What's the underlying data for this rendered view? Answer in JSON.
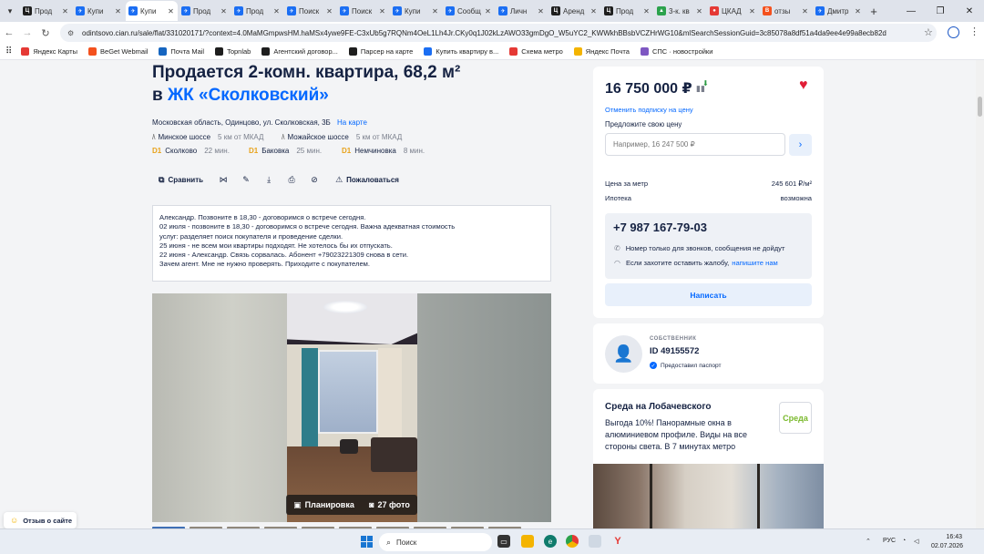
{
  "browser": {
    "tabs": [
      {
        "title": "Прод",
        "color": "#1e1e1e",
        "letter": "Ц"
      },
      {
        "title": "Купи",
        "color": "#1b6ef3",
        "letter": "✈"
      },
      {
        "title": "Купи",
        "color": "#1b6ef3",
        "letter": "✈",
        "active": true
      },
      {
        "title": "Прод",
        "color": "#1b6ef3",
        "letter": "✈"
      },
      {
        "title": "Прод",
        "color": "#1b6ef3",
        "letter": "✈"
      },
      {
        "title": "Поиск",
        "color": "#1b6ef3",
        "letter": "✈"
      },
      {
        "title": "Поиск",
        "color": "#1b6ef3",
        "letter": "✈"
      },
      {
        "title": "Купи",
        "color": "#1b6ef3",
        "letter": "✈"
      },
      {
        "title": "Сообщ",
        "color": "#1b6ef3",
        "letter": "✈"
      },
      {
        "title": "Личн",
        "color": "#1b6ef3",
        "letter": "✈"
      },
      {
        "title": "Аренд",
        "color": "#1e1e1e",
        "letter": "Ц"
      },
      {
        "title": "Прод",
        "color": "#1e1e1e",
        "letter": "Ц"
      },
      {
        "title": "3-к. кв",
        "color": "#2ba24c",
        "letter": "▲"
      },
      {
        "title": "ЦКАД",
        "color": "#e53935",
        "letter": "●"
      },
      {
        "title": "отзы",
        "color": "#f4511e",
        "letter": "B"
      },
      {
        "title": "Дмитр",
        "color": "#1b6ef3",
        "letter": "✈"
      }
    ],
    "url": "odintsovo.cian.ru/sale/flat/331020171/?context=4.0MaMGmpwsHM.haMSx4ywe9FE-C3xUb5g7RQNm4OeL1Lh4Jr.CKy0q1J02kLzAWO33gmDgO_W5uYC2_KWWkhBBsbVCZHrWG10&mlSearchSessionGuid=3c85078a8df51a4da9ee4e99a8ecb82d",
    "bookmarks": [
      {
        "label": "Яндекс Карты",
        "color": "#e53935"
      },
      {
        "label": "BeGet Webmail",
        "color": "#f4511e"
      },
      {
        "label": "Почта Mail",
        "color": "#1565c0"
      },
      {
        "label": "Topnlab",
        "color": "#1e1e1e"
      },
      {
        "label": "Агентский договор...",
        "color": "#1e1e1e"
      },
      {
        "label": "Парсер на карте",
        "color": "#1e1e1e"
      },
      {
        "label": "Купить квартиру в...",
        "color": "#1b6ef3"
      },
      {
        "label": "Схема метро",
        "color": "#e53935"
      },
      {
        "label": "Яндекс Почта",
        "color": "#f4b400"
      },
      {
        "label": "СПС · новостройки",
        "color": "#7e57c2"
      }
    ]
  },
  "listing": {
    "title": "Продается 2-комн. квартира, 68,2 м²",
    "complex_prefix": "в",
    "complex_name": "ЖК «Сколковский»",
    "address": "Московская область, Одинцово, ул. Сколковская, 3Б",
    "map_link": "На карте",
    "highways": [
      {
        "name": "Минское шоссе",
        "distance": "5 км от МКАД"
      },
      {
        "name": "Можайское шоссе",
        "distance": "5 км от МКАД"
      }
    ],
    "stations": [
      {
        "line": "D1",
        "name": "Сколково",
        "time": "22 мин."
      },
      {
        "line": "D1",
        "name": "Баковка",
        "time": "25 мин."
      },
      {
        "line": "D1",
        "name": "Немчиновка",
        "time": "8 мин."
      }
    ],
    "actions": {
      "compare": "Сравнить",
      "complain": "Пожаловаться"
    },
    "description": [
      "Александр. Позвоните в 18,30 - договоримся о встрече сегодня.",
      "02 июля - позвоните в 18,30 - договоримся о встрече сегодня.  Важна адекватная стоимость",
      "услуг: разделяет поиск покупателя и проведение сделки.",
      "25 июня - не всем мои квартиры подходят. Не хотелось бы их отпускать.",
      "22 июня - Александр. Связь сорвалась. Абонент +79023221309 снова в сети.",
      "Зачем агент. Мне не нужно проверять. Приходите с покупателем."
    ],
    "photo": {
      "layout_label": "Планировка",
      "photos_label": "27 фото"
    }
  },
  "sidebar": {
    "price": "16 750 000 ₽",
    "subscribe_link": "Отменить подписку на цену",
    "offer_label": "Предложите свою цену",
    "offer_placeholder": "Например, 16 247 500 ₽",
    "price_per_meter_label": "Цена за метр",
    "price_per_meter": "245 601 ₽/м²",
    "mortgage_label": "Ипотека",
    "mortgage": "возможна",
    "phone": "+7 987 167-79-03",
    "phone_note": "Номер только для звонков, сообщения не дойдут",
    "complaint_text": "Если захотите оставить жалобу,",
    "complaint_link": "напишите нам",
    "write_button": "Написать"
  },
  "owner": {
    "role": "СОБСТВЕННИК",
    "id": "ID 49155572",
    "passport": "Предоставил паспорт"
  },
  "ad": {
    "title": "Среда на Лобачевского",
    "text": "Выгода 10%! Панорамные окна в алюминиевом профиле. Виды на все стороны света. В 7 минутах метро",
    "logo": "Среда"
  },
  "feedback": "Отзыв о сайте",
  "taskbar": {
    "search_placeholder": "Поиск",
    "language": "РУС",
    "time": "16:43",
    "date": "02.07.2026"
  }
}
